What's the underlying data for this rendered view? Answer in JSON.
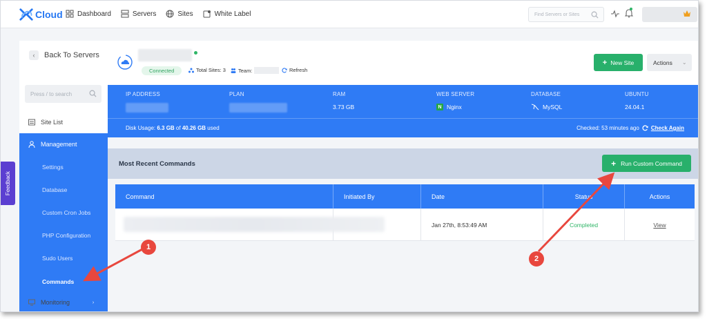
{
  "brand": {
    "logo_text": "Cloud"
  },
  "nav": [
    {
      "label": "Dashboard",
      "icon": "dashboard-icon"
    },
    {
      "label": "Servers",
      "icon": "servers-icon"
    },
    {
      "label": "Sites",
      "icon": "globe-icon"
    },
    {
      "label": "White Label",
      "icon": "white-label-icon"
    }
  ],
  "top_search": {
    "placeholder": "Find Servers or Sites"
  },
  "sidebar": {
    "back_label": "Back To Servers",
    "search_placeholder": "Press / to search",
    "site_list_label": "Site List",
    "management_label": "Management",
    "sub_items": [
      "Settings",
      "Database",
      "Custom Cron Jobs",
      "PHP Configuration",
      "Sudo Users",
      "Commands"
    ],
    "active_sub_item": "Commands",
    "monitoring_label": "Monitoring"
  },
  "feedback": {
    "label": "Feedback"
  },
  "server": {
    "status": "Connected",
    "total_sites_label": "Total Sites: 3",
    "team_label": "Team:",
    "refresh_label": "Refresh",
    "new_site_label": "New Site",
    "actions_label": "Actions"
  },
  "info": {
    "ip_label": "IP ADDRESS",
    "plan_label": "PLAN",
    "ram_label": "RAM",
    "ram_value": "3.73 GB",
    "webserver_label": "WEB SERVER",
    "webserver_value": "Nginx",
    "database_label": "DATABASE",
    "database_value": "MySQL",
    "os_label": "UBUNTU",
    "os_value": "24.04.1",
    "disk_prefix": "Disk Usage: ",
    "disk_used": "6.3 GB",
    "disk_of": " of ",
    "disk_total": "40.26 GB",
    "disk_suffix": " used",
    "checked_text": "Checked: 53 minutes ago",
    "check_again": "Check Again"
  },
  "commands": {
    "title": "Most Recent Commands",
    "run_button": "Run Custom Command",
    "columns": [
      "Command",
      "Initiated By",
      "Date",
      "Status",
      "Actions"
    ],
    "rows": [
      {
        "date": "Jan 27th, 8:53:49 AM",
        "status": "Completed",
        "action": "View"
      }
    ]
  },
  "annotations": [
    "1",
    "2"
  ],
  "colors": {
    "primary": "#2f7bf5",
    "success": "#28b06b",
    "arrow": "#e8473e",
    "feedback": "#5b3fd1"
  }
}
